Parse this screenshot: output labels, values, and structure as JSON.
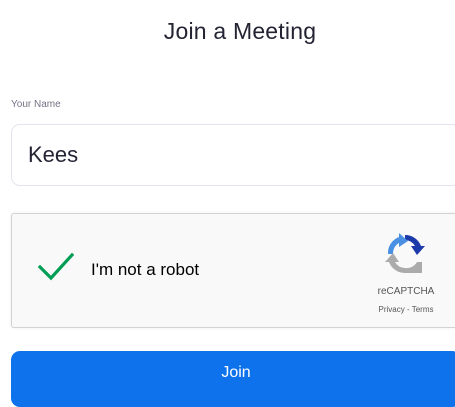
{
  "page": {
    "title": "Join a Meeting"
  },
  "form": {
    "name_label": "Your Name",
    "name_value": "Kees"
  },
  "captcha": {
    "label": "I'm not a robot",
    "checked": true,
    "brand": "reCAPTCHA",
    "privacy_link": "Privacy",
    "separator": " - ",
    "terms_link": "Terms",
    "check_color": "#009e55"
  },
  "join": {
    "label": "Join",
    "color": "#0e72ed"
  }
}
